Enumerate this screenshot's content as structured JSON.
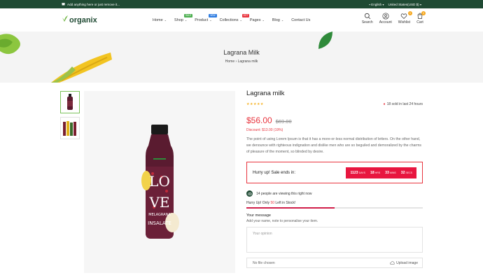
{
  "topbar": {
    "message": "Add anything here or just remove it...",
    "language": "English",
    "currency": "United States(USD $)"
  },
  "header": {
    "logo": "organix",
    "nav": [
      {
        "label": "Home",
        "badge": ""
      },
      {
        "label": "Shop",
        "badge": "SALE",
        "badge_color": "#4caf50"
      },
      {
        "label": "Product",
        "badge": "NEW",
        "badge_color": "#2f7de1"
      },
      {
        "label": "Collections",
        "badge": "HOT",
        "badge_color": "#e8343e"
      },
      {
        "label": "Pages",
        "badge": ""
      },
      {
        "label": "Blog",
        "badge": ""
      },
      {
        "label": "Contact Us",
        "badge": ""
      }
    ],
    "icons": [
      {
        "label": "Search",
        "icon": "search-icon",
        "count": ""
      },
      {
        "label": "Account",
        "icon": "user-icon",
        "count": ""
      },
      {
        "label": "Wishlist",
        "icon": "heart-icon",
        "count": "0"
      },
      {
        "label": "Cart",
        "icon": "cart-icon",
        "count": "0"
      }
    ]
  },
  "banner": {
    "title": "Lagrana Milk",
    "crumb_home": "Home",
    "crumb_sep": "›",
    "crumb_current": "Lagrana milk"
  },
  "product": {
    "title": "Lagrana milk",
    "stars": "★★★★★",
    "sold": "18 sold in last 24 hours",
    "price": "$56.00",
    "old_price": "$69.00",
    "discount": "Discount: $13.00 (19%)",
    "description": "The point of using Lorem Ipsum is that it has a more-or-less normal distribution of letters. On the other hand, we denounce with righteous indignation and dislike men who are so beguiled and demoralized by the charms of pleasure of the moment, so blinded by desire.",
    "sale_label": "Hurry up! Sale ends in:",
    "timer": [
      {
        "v": "1123",
        "u": "DAYS"
      },
      {
        "v": "18",
        "u": "HRS"
      },
      {
        "v": "33",
        "u": "MINS"
      },
      {
        "v": "32",
        "u": "SECS"
      }
    ],
    "viewing": "14 people are viewing this right now",
    "stock_pre": "Hurry Up! Only ",
    "stock_n": "50",
    "stock_post": " Left in Stock!",
    "stock_fraction": 0.5,
    "message_heading": "Your message",
    "message_sub": "Add your name, note to personalise your item.",
    "opinion_placeholder": "Your opinion",
    "file_text": "No file chosen",
    "upload_label": "Upload image"
  },
  "bottle": {
    "label_top": "LO",
    "label_mid": "VE",
    "brand": "MELAGRANA",
    "word": "INSALATE"
  },
  "colors": {
    "dark_green": "#1f4a33",
    "accent_red": "#e8343e",
    "timer_red": "#e8163f",
    "star": "#f6b01e"
  }
}
